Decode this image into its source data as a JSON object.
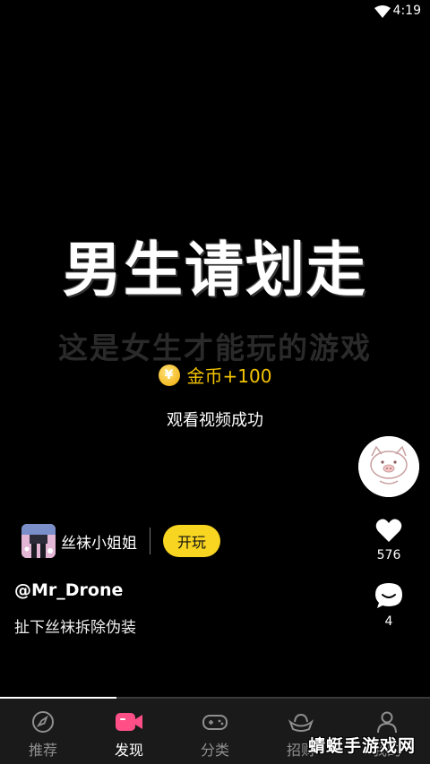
{
  "status_bar": {
    "time": "4:19"
  },
  "video": {
    "headline": "男生请划走",
    "subline": "这是女生才能玩的游戏"
  },
  "reward_toast": {
    "coin_symbol": "¥",
    "coin_text": "金币+100",
    "message": "观看视频成功"
  },
  "game": {
    "name": "丝袜小姐姐",
    "play_label": "开玩"
  },
  "post": {
    "author": "@Mr_Drone",
    "caption": "扯下丝袜拆除伪装"
  },
  "actions": {
    "likes": "576",
    "comments": "4"
  },
  "progress": {
    "fraction": 0.27
  },
  "nav": {
    "items": [
      {
        "label": "推荐",
        "icon": "compass-icon",
        "active": false
      },
      {
        "label": "发现",
        "icon": "video-camera-icon",
        "active": true
      },
      {
        "label": "分类",
        "icon": "gamepad-icon",
        "active": false
      },
      {
        "label": "招财",
        "icon": "gold-ingot-icon",
        "active": false
      },
      {
        "label": "我的",
        "icon": "user-icon",
        "active": false
      }
    ]
  },
  "watermark": "蜻蜓手游戏网",
  "colors": {
    "accent": "#f7d520",
    "coin": "#f5c400",
    "active_nav_icon": "#ff4f86"
  }
}
